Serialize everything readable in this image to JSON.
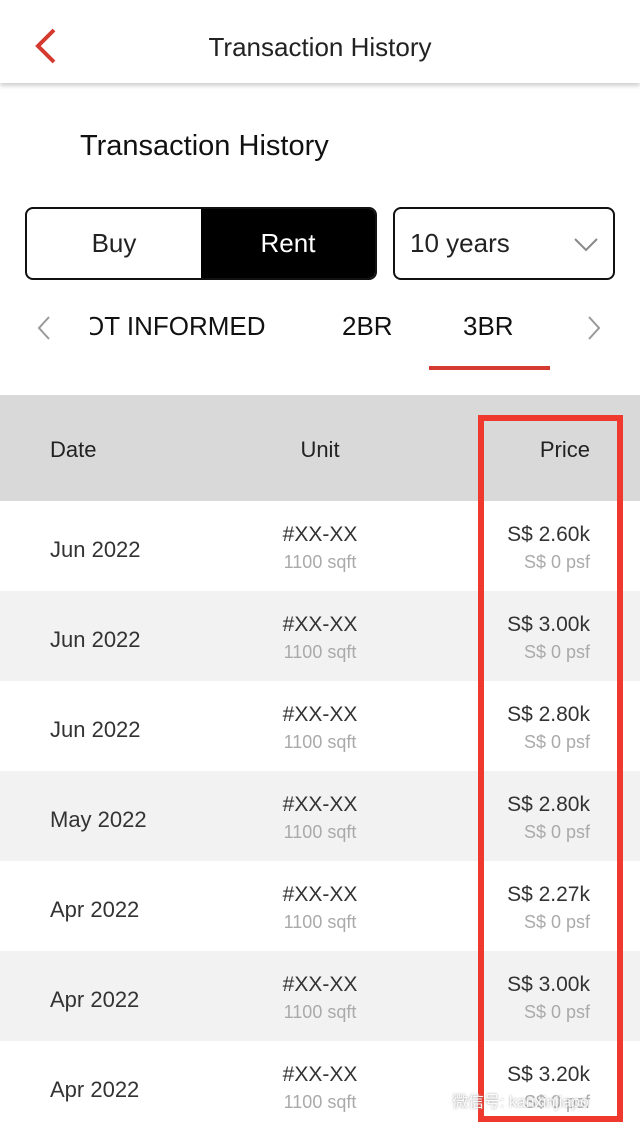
{
  "header": {
    "title": "Transaction History",
    "back_icon": "chevron-left-icon",
    "accent": "#d43a2f"
  },
  "page_title": "Transaction History",
  "segment": {
    "options": [
      "Buy",
      "Rent"
    ],
    "selected": "Rent"
  },
  "period": {
    "value": "10 years"
  },
  "tabs": {
    "items": [
      "OT INFORMED",
      "2BR",
      "3BR"
    ],
    "selected": "3BR"
  },
  "table": {
    "headers": {
      "date": "Date",
      "unit": "Unit",
      "price": "Price"
    },
    "rows": [
      {
        "date": "Jun 2022",
        "unit": "#XX-XX",
        "size": "1100 sqft",
        "price": "S$ 2.60k",
        "psf": "S$ 0 psf"
      },
      {
        "date": "Jun 2022",
        "unit": "#XX-XX",
        "size": "1100 sqft",
        "price": "S$ 3.00k",
        "psf": "S$ 0 psf"
      },
      {
        "date": "Jun 2022",
        "unit": "#XX-XX",
        "size": "1100 sqft",
        "price": "S$ 2.80k",
        "psf": "S$ 0 psf"
      },
      {
        "date": "May 2022",
        "unit": "#XX-XX",
        "size": "1100 sqft",
        "price": "S$ 2.80k",
        "psf": "S$ 0 psf"
      },
      {
        "date": "Apr 2022",
        "unit": "#XX-XX",
        "size": "1100 sqft",
        "price": "S$ 2.27k",
        "psf": "S$ 0 psf"
      },
      {
        "date": "Apr 2022",
        "unit": "#XX-XX",
        "size": "1100 sqft",
        "price": "S$ 3.00k",
        "psf": "S$ 0 psf"
      },
      {
        "date": "Apr 2022",
        "unit": "#XX-XX",
        "size": "1100 sqft",
        "price": "S$ 3.20k",
        "psf": "S$ 0 psf"
      }
    ]
  },
  "highlight_color": "#f0392e",
  "watermark": "微信号: kanxinjiapo"
}
